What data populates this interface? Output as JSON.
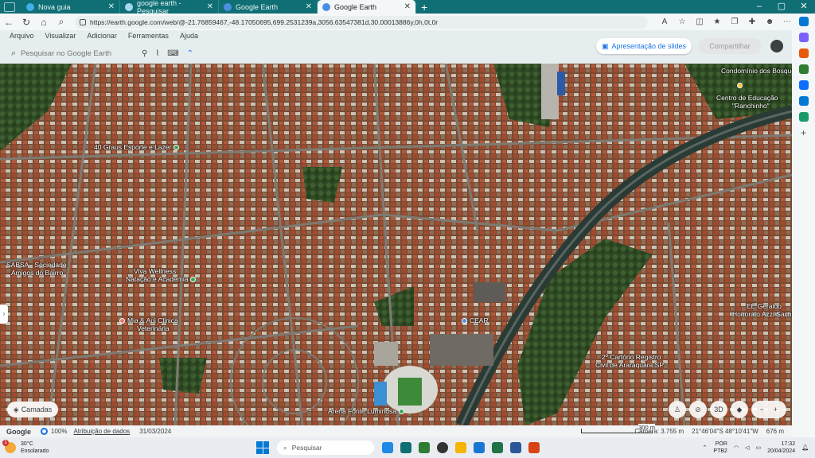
{
  "browser": {
    "tabs": [
      {
        "label": "",
        "icon": "tab-actions-icon",
        "color": "#e8f4f4",
        "active": false
      },
      {
        "label": "Nova guia",
        "icon": "edge-icon",
        "color": "#3fb0e8",
        "active": false
      },
      {
        "label": "google earth - Pesquisar",
        "icon": "search-tab-icon",
        "color": "#a4d8f0",
        "active": false
      },
      {
        "label": "Google Earth",
        "icon": "earth-icon",
        "color": "#4a90e2",
        "active": false
      },
      {
        "label": "Google Earth",
        "icon": "earth-icon",
        "color": "#4a90e2",
        "active": true
      }
    ],
    "new_tab": "+",
    "url": "https://earth.google.com/web/@-21.76859467,-48.17050695,699.2531239a,3056.63547381d,30.00013886y,0h,0t,0r"
  },
  "earth": {
    "menu": [
      "Arquivo",
      "Visualizar",
      "Adicionar",
      "Ferramentas",
      "Ajuda"
    ],
    "search_placeholder": "Pesquisar no Google Earth",
    "slides_label": "Apresentação de slides",
    "share_label": "Compartilhar",
    "layers_label": "Camadas",
    "view_3d": "3D",
    "zoom_minus": "−",
    "zoom_plus": "+"
  },
  "map_labels": [
    {
      "text": "Condomínio dos Bosque",
      "pin": false
    },
    {
      "text": "Centro de Educação",
      "pin": true,
      "pin_color": "#f2c230"
    },
    {
      "text": "\"Ranchinho\"",
      "pin": false
    },
    {
      "text": "40 Graus Esporte e Lazer",
      "pin": true,
      "pin_color": "#34a853"
    },
    {
      "text": "SABSA - Sociedade",
      "pin": false
    },
    {
      "text": "Amigos do Bairro",
      "pin": false
    },
    {
      "text": "Viva Wellness",
      "pin": false
    },
    {
      "text": "Natação e Academia",
      "pin": true,
      "pin_color": "#34a853"
    },
    {
      "text": "Mia & Aui Clinica",
      "pin": false
    },
    {
      "text": "Veterinária",
      "pin": false
    },
    {
      "text": "CEAR",
      "pin": true,
      "pin_color": "#4a90e2"
    },
    {
      "text": "EE Geraldo",
      "pin": false
    },
    {
      "text": "Honorato Azzi Sache",
      "pin": false
    },
    {
      "text": "2º Cartório Registro",
      "pin": false
    },
    {
      "text": "Civil de Araraquara SP",
      "pin": false
    },
    {
      "text": "Arena Fonte Luminosa",
      "pin": true,
      "pin_color": "#34a853"
    }
  ],
  "status": {
    "brand": "Google",
    "zoom": "100%",
    "attribution": "Atribuição de dados",
    "date": "31/03/2024",
    "scale": "300 m",
    "camera": "Câmera: 3.755 m",
    "coords": "21°46'04\"S 48°10'41\"W",
    "elevation": "676 m"
  },
  "taskbar": {
    "temp": "30°C",
    "condition": "Ensolarado",
    "badge": "1",
    "search_placeholder": "Pesquisar",
    "lang1": "POR",
    "lang2": "PTB2",
    "time": "17:32",
    "date": "20/04/2024",
    "app_colors": [
      "#1e88e5",
      "#0f6f75",
      "#2e7d32",
      "#333333",
      "#f4b400",
      "#1976d2",
      "#217346",
      "#2b579a",
      "#d84315"
    ]
  },
  "edge_sidebar_colors": [
    "#0078d4",
    "#7b61ff",
    "#e8590c",
    "#2e7d32",
    "#0d6efd",
    "#0078d4",
    "#1a9a6b",
    "#555555"
  ]
}
